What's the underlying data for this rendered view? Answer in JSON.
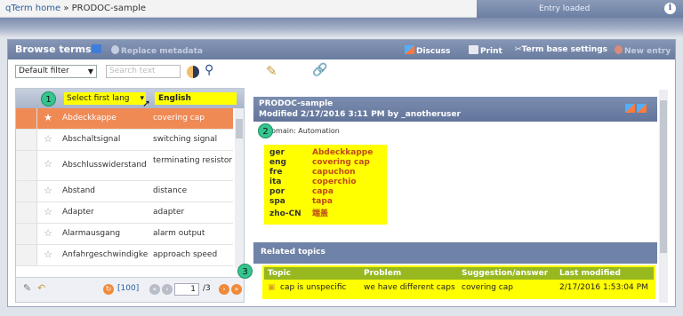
{
  "breadcrumb": {
    "home": "qTerm home",
    "separator": "»",
    "current": "PRODOC-sample"
  },
  "status": {
    "text": "Entry loaded",
    "info_icon": "info-icon"
  },
  "panel": {
    "title": "Browse terms",
    "replace_metadata": "Replace metadata",
    "discuss": "Discuss",
    "print": "Print",
    "term_base_settings": "Term base settings",
    "new_entry": "New entry"
  },
  "toolbar": {
    "filter_value": "Default filter",
    "search_placeholder": "Search text"
  },
  "grid": {
    "source_header": "Select first lang",
    "target_header": "English",
    "rows": [
      {
        "source": "Abdeckkappe",
        "target": "covering cap"
      },
      {
        "source": "Abschaltsignal",
        "target": "switching signal"
      },
      {
        "source": "Abschlusswiderstand",
        "target": "terminating resistor"
      },
      {
        "source": "Abstand",
        "target": "distance"
      },
      {
        "source": "Adapter",
        "target": "adapter"
      },
      {
        "source": "Alarmausgang",
        "target": "alarm output"
      },
      {
        "source": "Anfahrgeschwindigkeit",
        "target": "approach speed"
      }
    ],
    "records": "[100]",
    "page": "1",
    "of_pages": "/3"
  },
  "detail": {
    "title": "PRODOC-sample",
    "modified": "Modified 2/17/2016 3:11 PM by _anotheruser",
    "domain": "Domain: Automation",
    "terms": [
      {
        "lang": "ger",
        "term": "Abdeckkappe"
      },
      {
        "lang": "eng",
        "term": "covering cap"
      },
      {
        "lang": "fre",
        "term": "capuchon"
      },
      {
        "lang": "ita",
        "term": "coperchio"
      },
      {
        "lang": "por",
        "term": "capa"
      },
      {
        "lang": "spa",
        "term": "tapa"
      },
      {
        "lang": "zho-CN",
        "term": "端盖"
      }
    ]
  },
  "related": {
    "title": "Related topics",
    "headers": {
      "topic": "Topic",
      "problem": "Problem",
      "suggestion": "Suggestion/answer",
      "last_modified": "Last modified"
    },
    "row": {
      "topic": "cap is unspecific",
      "problem": "we have different caps",
      "suggestion": "covering cap",
      "last_modified": "2/17/2016 1:53:04 PM"
    }
  },
  "badges": [
    "1",
    "2",
    "3"
  ],
  "colors": {
    "highlight": "#ffff00",
    "selected_row": "#f08a55",
    "header_band": "#6a7ca0",
    "badge": "#35c58e"
  }
}
